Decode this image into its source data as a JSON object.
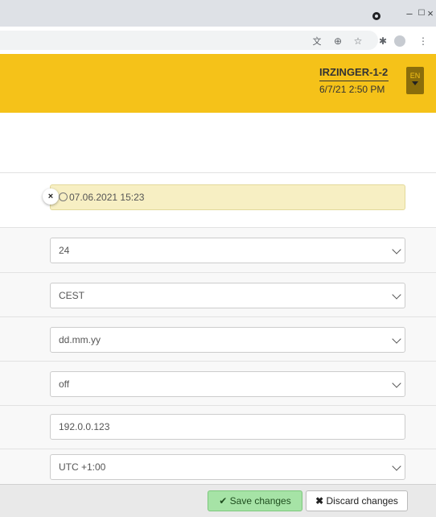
{
  "browser": {
    "window_controls": {
      "minimize": "–",
      "maximize": "☐",
      "close": "×"
    },
    "toolbar_icons": [
      "translate-icon",
      "zoom-icon",
      "star-icon",
      "extensions-icon",
      "profile-icon",
      "menu-icon"
    ]
  },
  "header": {
    "device_name": "IRZINGER-1-2",
    "device_time": "6/7/21 2:50 PM",
    "language": "EN"
  },
  "form": {
    "fields": [
      {
        "value": "07.06.2021 15:23",
        "type": "datetime",
        "clear_label": "×"
      },
      {
        "value": "24",
        "type": "select"
      },
      {
        "value": "CEST",
        "type": "select"
      },
      {
        "value": "dd.mm.yy",
        "type": "select"
      },
      {
        "value": "off",
        "type": "select"
      },
      {
        "value": "192.0.0.123",
        "type": "text"
      },
      {
        "value": "UTC +1:00",
        "type": "select"
      }
    ]
  },
  "footer": {
    "save_label": "Save changes",
    "discard_label": "Discard changes"
  },
  "colors": {
    "accent_yellow": "#f5c219",
    "highlight_field": "#f7efc3",
    "save_green": "#a6e3a6"
  }
}
